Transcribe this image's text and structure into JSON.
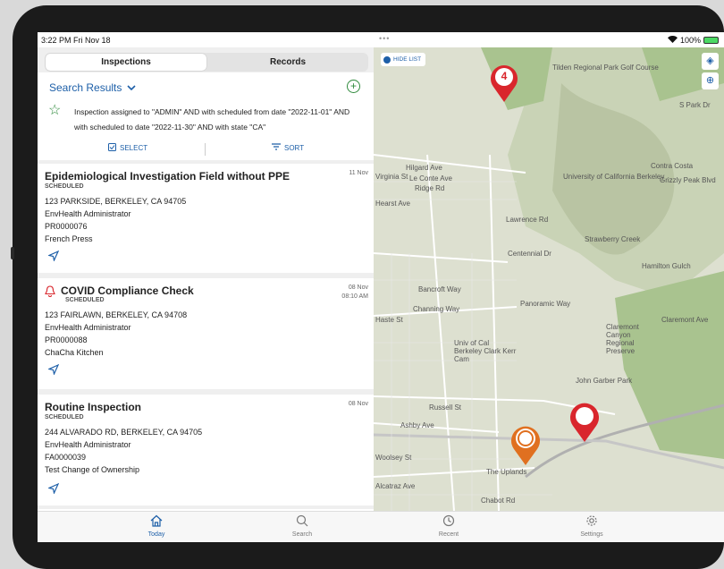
{
  "status": {
    "time": "3:22 PM  Fri Nov 18",
    "battery": "100%"
  },
  "tabs_top": [
    {
      "label": "Inspections"
    },
    {
      "label": "Records"
    }
  ],
  "search": {
    "title": "Search Results",
    "query": "Inspection assigned to \"ADMIN\" AND with scheduled from date \"2022-11-01\" AND with scheduled to date \"2022-11-30\" AND with state \"CA\"",
    "select_label": "SELECT",
    "sort_label": "SORT"
  },
  "cards": [
    {
      "title": "Epidemiological Investigation Field without PPE",
      "status": "SCHEDULED",
      "date": "11 Nov",
      "time": "",
      "address": "123 PARKSIDE, BERKELEY, CA 94705",
      "assignee": "EnvHealth Administrator",
      "record": "PR0000076",
      "business": "French Press"
    },
    {
      "title": "COVID Compliance Check",
      "status": "SCHEDULED",
      "date": "08 Nov",
      "time": "08:10 AM",
      "address": "123 FAIRLAWN, BERKELEY, CA 94708",
      "assignee": "EnvHealth Administrator",
      "record": "PR0000088",
      "business": "ChaCha Kitchen"
    },
    {
      "title": "Routine Inspection",
      "status": "SCHEDULED",
      "date": "08 Nov",
      "time": "",
      "address": "244 ALVARADO RD, BERKELEY, CA 94705",
      "assignee": "EnvHealth Administrator",
      "record": "FA0000039",
      "business": "Test Change of Ownership"
    }
  ],
  "map": {
    "hide_list": "HIDE LIST",
    "cluster_count": "4",
    "labels": [
      "Tilden Regional Park Golf Course",
      "Hilgard Ave",
      "Le Conte Ave",
      "Ridge Rd",
      "Virginia St",
      "Hearst Ave",
      "University of California Berkeley",
      "Lawrence Rd",
      "Strawberry Creek",
      "Centennial Dr",
      "Hamilton Gulch",
      "Bancroft Way",
      "Channing Way",
      "Haste St",
      "Univ of Cal Berkeley Clark Kerr Cam",
      "Claremont Canyon Regional Preserve",
      "Russell St",
      "Ashby Ave",
      "Woolsey St",
      "The Uplands",
      "Alcatraz Ave",
      "Chabot Rd",
      "John Garber Park",
      "Contra Costa",
      "Grizzly Peak Blvd",
      "S Park Dr",
      "Panoramic Way",
      "Claremont Ave"
    ]
  },
  "bottom_tabs": [
    {
      "label": "Today",
      "icon": "home-icon"
    },
    {
      "label": "Search",
      "icon": "search-icon"
    },
    {
      "label": "Recent",
      "icon": "clock-icon"
    },
    {
      "label": "Settings",
      "icon": "gear-icon"
    }
  ],
  "colors": {
    "accent": "#1d5fa8",
    "green": "#2f8a3c",
    "pin_red": "#d9262c",
    "pin_orange": "#e07020"
  }
}
